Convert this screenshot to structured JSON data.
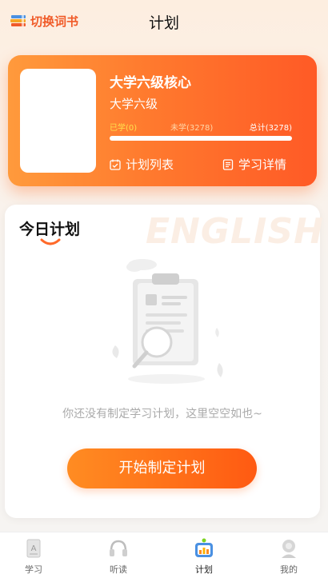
{
  "header": {
    "switch_label": "切换词书",
    "title": "计划"
  },
  "plan": {
    "book_name": "大学六级核心",
    "book_sub": "大学六级",
    "learned_label": "已学(0)",
    "unlearned_label": "未学(3278)",
    "total_label": "总计(3278)",
    "progress": 0.0,
    "plan_list_label": "计划列表",
    "study_detail_label": "学习详情"
  },
  "today": {
    "title": "今日计划",
    "watermark": "ENGLISH",
    "empty_text": "你还没有制定学习计划，这里空空如也~",
    "start_button": "开始制定计划"
  },
  "tabs": [
    {
      "label": "学习",
      "icon": "study-icon",
      "active": false
    },
    {
      "label": "听读",
      "icon": "headphones-icon",
      "active": false
    },
    {
      "label": "计划",
      "icon": "plan-icon",
      "active": true
    },
    {
      "label": "我的",
      "icon": "profile-icon",
      "active": false
    }
  ],
  "colors": {
    "accent": "#ff6a2a",
    "learned": "#ffe14d"
  }
}
